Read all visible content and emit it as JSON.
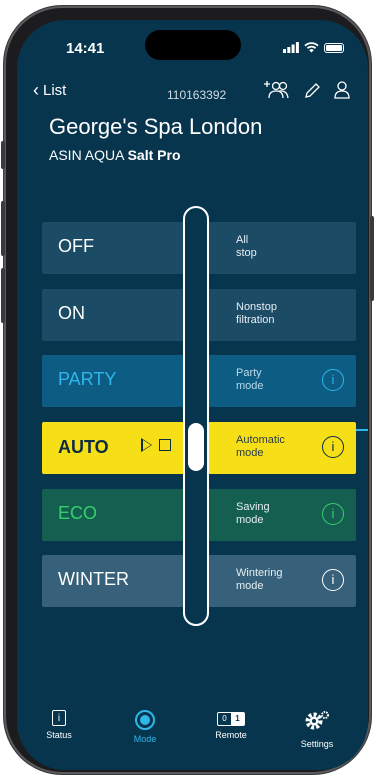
{
  "status_bar": {
    "time": "14:41"
  },
  "header": {
    "back_label": "List",
    "device_id": "110163392",
    "spa_name": "George's Spa London",
    "model_prefix": "ASIN AQUA",
    "model_bold": "Salt Pro"
  },
  "modes": [
    {
      "name": "OFF",
      "desc_line1": "All",
      "desc_line2": "stop",
      "info": false
    },
    {
      "name": "ON",
      "desc_line1": "Nonstop",
      "desc_line2": "filtration",
      "info": false
    },
    {
      "name": "PARTY",
      "desc_line1": "Party",
      "desc_line2": "mode",
      "info": true,
      "color": "#2fb6ea"
    },
    {
      "name": "AUTO",
      "desc_line1": "Automatic",
      "desc_line2": "mode",
      "info": true,
      "selected": true,
      "color": "#f7df17"
    },
    {
      "name": "ECO",
      "desc_line1": "Saving",
      "desc_line2": "mode",
      "info": true,
      "color": "#35cf6e"
    },
    {
      "name": "WINTER",
      "desc_line1": "Wintering",
      "desc_line2": "mode",
      "info": true
    }
  ],
  "info_glyph": "i",
  "tabs": [
    {
      "label": "Status",
      "icon": "status-icon"
    },
    {
      "label": "Mode",
      "icon": "mode-icon",
      "active": true
    },
    {
      "label": "Remote",
      "icon": "remote-icon",
      "left_digit": "0",
      "right_digit": "1"
    },
    {
      "label": "Settings",
      "icon": "settings-gear-icon"
    }
  ],
  "colors": {
    "background": "#08354e",
    "accent": "#2fb6ea",
    "selected": "#f7df17",
    "eco": "#35cf6e"
  }
}
